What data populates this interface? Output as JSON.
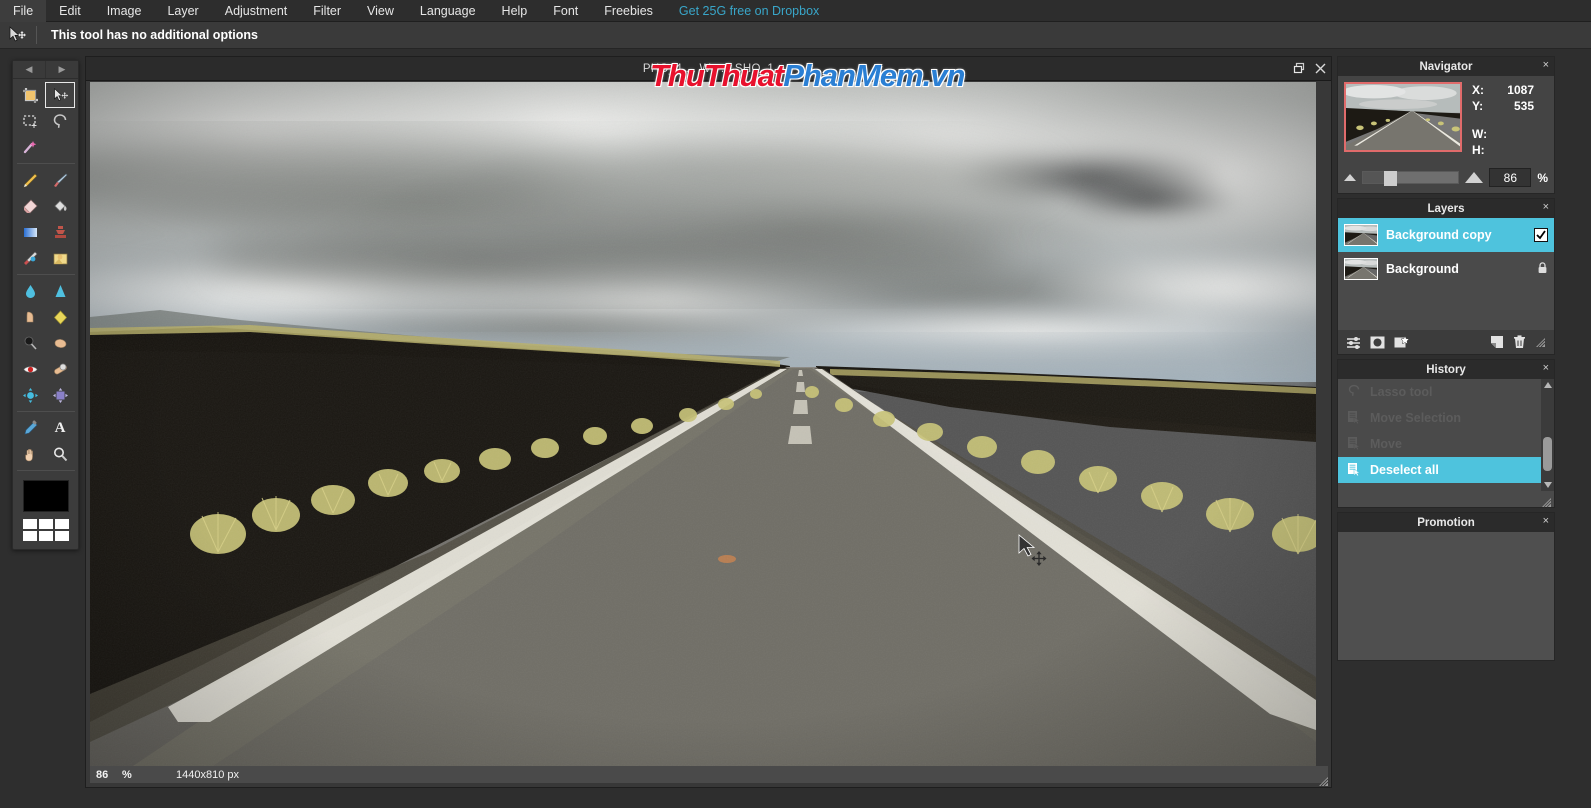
{
  "menubar": {
    "items": [
      {
        "label": "File"
      },
      {
        "label": "Edit"
      },
      {
        "label": "Image"
      },
      {
        "label": "Layer"
      },
      {
        "label": "Adjustment"
      },
      {
        "label": "Filter"
      },
      {
        "label": "View"
      },
      {
        "label": "Language"
      },
      {
        "label": "Help"
      },
      {
        "label": "Font"
      },
      {
        "label": "Freebies"
      }
    ],
    "promo": {
      "label": "Get 25G free on Dropbox",
      "color": "#39a6c9"
    }
  },
  "options_bar": {
    "tool_icon": "move-tool-icon",
    "text": "This tool has no additional options"
  },
  "toolbox": {
    "nav_prev": "◀",
    "nav_next": "▶",
    "tools": [
      {
        "name": "crop-tool",
        "glyph": "⛏",
        "active": false
      },
      {
        "name": "move-tool",
        "glyph": "➤",
        "active": true
      },
      {
        "name": "marquee-select-tool",
        "glyph": "⬚",
        "active": false
      },
      {
        "name": "lasso-tool",
        "glyph": "⊂",
        "active": false
      },
      {
        "name": "magic-wand-tool",
        "glyph": "✨",
        "active": false
      },
      {
        "name": "pencil-tool",
        "glyph": "✏",
        "active": false
      },
      {
        "name": "brush-tool",
        "glyph": "὘C",
        "active": false
      },
      {
        "name": "eraser-tool",
        "glyph": "▱",
        "active": false
      },
      {
        "name": "paint-bucket-tool",
        "glyph": "◗",
        "active": false
      },
      {
        "name": "gradient-tool",
        "glyph": "■",
        "active": false
      },
      {
        "name": "clone-stamp-tool",
        "glyph": "⚑",
        "active": false
      },
      {
        "name": "healing-brush-tool",
        "glyph": "✂",
        "active": false
      },
      {
        "name": "replace-color-tool",
        "glyph": "▣",
        "active": false
      },
      {
        "name": "blur-tool",
        "glyph": "Ὂ7",
        "active": false
      },
      {
        "name": "sharpen-tool",
        "glyph": "▲",
        "active": false
      },
      {
        "name": "smudge-tool",
        "glyph": "☝",
        "active": false
      },
      {
        "name": "sponge-tool",
        "glyph": "◆",
        "active": false
      },
      {
        "name": "dodge-tool",
        "glyph": "⚫",
        "active": false
      },
      {
        "name": "burn-tool",
        "glyph": "✊",
        "active": false
      },
      {
        "name": "red-eye-tool",
        "glyph": "◉",
        "active": false
      },
      {
        "name": "bandage-tool",
        "glyph": "⚕",
        "active": false
      },
      {
        "name": "bloat-tool",
        "glyph": "●",
        "active": false
      },
      {
        "name": "pinch-tool",
        "glyph": "◈",
        "active": false
      },
      {
        "name": "eyedropper-tool",
        "glyph": "✒",
        "active": false
      },
      {
        "name": "type-tool",
        "glyph": "A",
        "active": false
      },
      {
        "name": "hand-tool",
        "glyph": "✋",
        "active": false
      },
      {
        "name": "zoom-tool",
        "glyph": "⚲",
        "active": false
      }
    ],
    "foreground_color": "#000000",
    "palette_swatches": [
      "#ffffff",
      "#ffffff",
      "#ffffff",
      "#ffffff",
      "#ffffff",
      "#ffffff"
    ]
  },
  "document": {
    "title": "PHO_4 ... W_ ... SHO_1",
    "restore_icon": "restore-window-icon",
    "close_icon": "close-window-icon",
    "status": {
      "zoom_value": "86",
      "zoom_unit": "%",
      "dimensions": "1440x810 px"
    },
    "watermark": {
      "part1": "Thu",
      "part2": "Thuat",
      "part3": "PhanMem",
      "part4": ".vn",
      "color_red": "#e8112d",
      "color_blue": "#2a7fd4"
    }
  },
  "panels": {
    "navigator": {
      "title": "Navigator",
      "close": "×",
      "x_label": "X:",
      "x_value": "1087",
      "y_label": "Y:",
      "y_value": "535",
      "w_label": "W:",
      "w_value": "",
      "h_label": "H:",
      "h_value": "",
      "zoom_value": "86",
      "zoom_unit": "%"
    },
    "layers": {
      "title": "Layers",
      "close": "×",
      "rows": [
        {
          "name": "Background copy",
          "selected": true,
          "visible": true,
          "locked": false,
          "check": "✔"
        },
        {
          "name": "Background",
          "selected": false,
          "visible": true,
          "locked": true,
          "lock_glyph": "ὑ2"
        }
      ],
      "tools": [
        {
          "name": "layer-settings-button",
          "glyph": "☷"
        },
        {
          "name": "layer-mask-button",
          "glyph": "⬤"
        },
        {
          "name": "layer-styles-button",
          "glyph": "✦"
        },
        {
          "name": "duplicate-layer-button",
          "glyph": "◢"
        },
        {
          "name": "delete-layer-button",
          "glyph": "Ὕ1"
        }
      ]
    },
    "history": {
      "title": "History",
      "close": "×",
      "rows": [
        {
          "label": "Lasso tool",
          "icon": "lasso-icon",
          "glyph": "◯",
          "state": "undone"
        },
        {
          "label": "Move Selection",
          "icon": "document-move-icon",
          "glyph": "὜B",
          "state": "undone"
        },
        {
          "label": "Move",
          "icon": "document-move-icon",
          "glyph": "὜B",
          "state": "undone"
        },
        {
          "label": "Deselect all",
          "icon": "document-move-icon",
          "glyph": "὜B",
          "state": "current"
        }
      ]
    },
    "promotion": {
      "title": "Promotion",
      "close": "×"
    }
  },
  "colors": {
    "accent": "#4ec3dd",
    "panel_bg": "#444444",
    "header_bg": "#2b2b2b",
    "toolbar_bg": "#3c3c3c",
    "link": "#39a6c9"
  }
}
